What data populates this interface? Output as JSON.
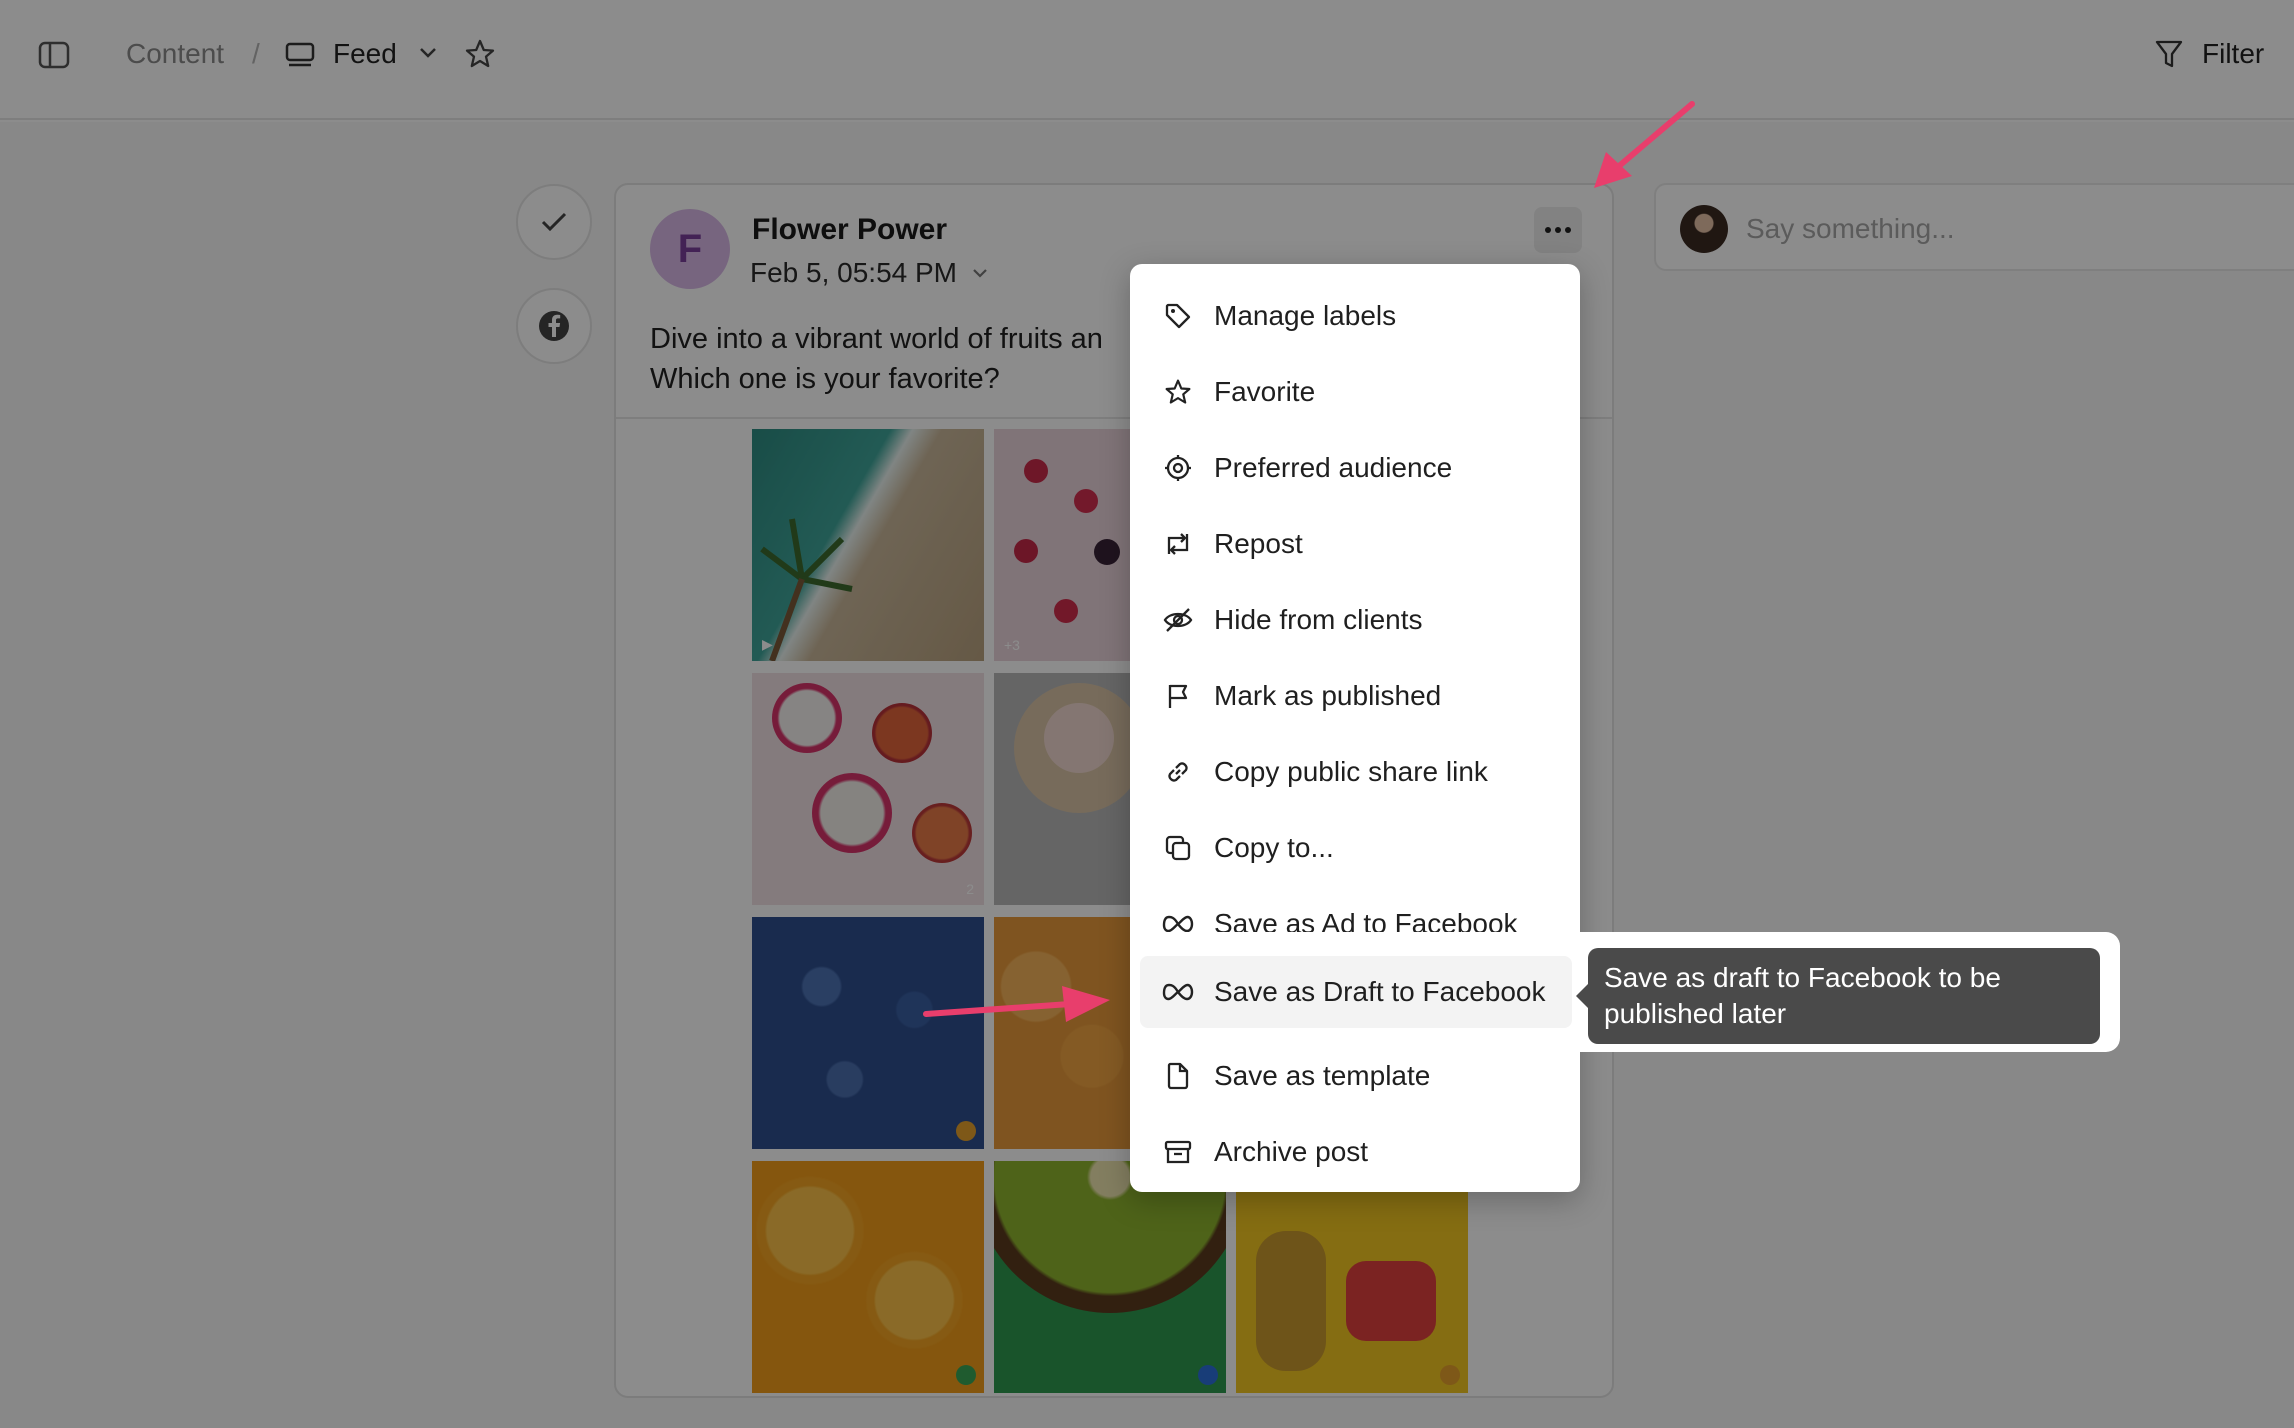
{
  "topbar": {
    "breadcrumb_root": "Content",
    "separator": "/",
    "view_name": "Feed",
    "filter_label": "Filter"
  },
  "post": {
    "avatar_initial": "F",
    "author": "Flower Power",
    "datetime": "Feb 5, 05:54 PM",
    "caption_line1": "Dive into a vibrant world of fruits an",
    "caption_line2": "Which one is your favorite?",
    "thumb_badges": {
      "t2": "+3",
      "t3": "2"
    }
  },
  "comment": {
    "placeholder": "Say something..."
  },
  "menu": {
    "items": [
      {
        "label": "Manage labels",
        "icon": "tag-icon"
      },
      {
        "label": "Favorite",
        "icon": "star-icon"
      },
      {
        "label": "Preferred audience",
        "icon": "target-icon"
      },
      {
        "label": "Repost",
        "icon": "repost-icon"
      },
      {
        "label": "Hide from clients",
        "icon": "eye-off-icon"
      },
      {
        "label": "Mark as published",
        "icon": "flag-icon"
      },
      {
        "label": "Copy public share link",
        "icon": "link-icon"
      },
      {
        "label": "Copy to...",
        "icon": "copy-icon"
      },
      {
        "label": "Save as Ad to Facebook",
        "icon": "meta-icon"
      },
      {
        "label": "Save as Draft to Facebook",
        "icon": "meta-icon"
      },
      {
        "label": "Save as template",
        "icon": "file-icon"
      },
      {
        "label": "Archive post",
        "icon": "archive-icon"
      }
    ]
  },
  "tooltip": {
    "line1": "Save as draft to Facebook to be",
    "line2": "published later"
  },
  "colors": {
    "annotation_arrow": "#e83e6c",
    "avatar_bg": "#d9b9e8",
    "avatar_fg": "#7a3f9b",
    "tooltip_bg": "#4a4a4a"
  }
}
